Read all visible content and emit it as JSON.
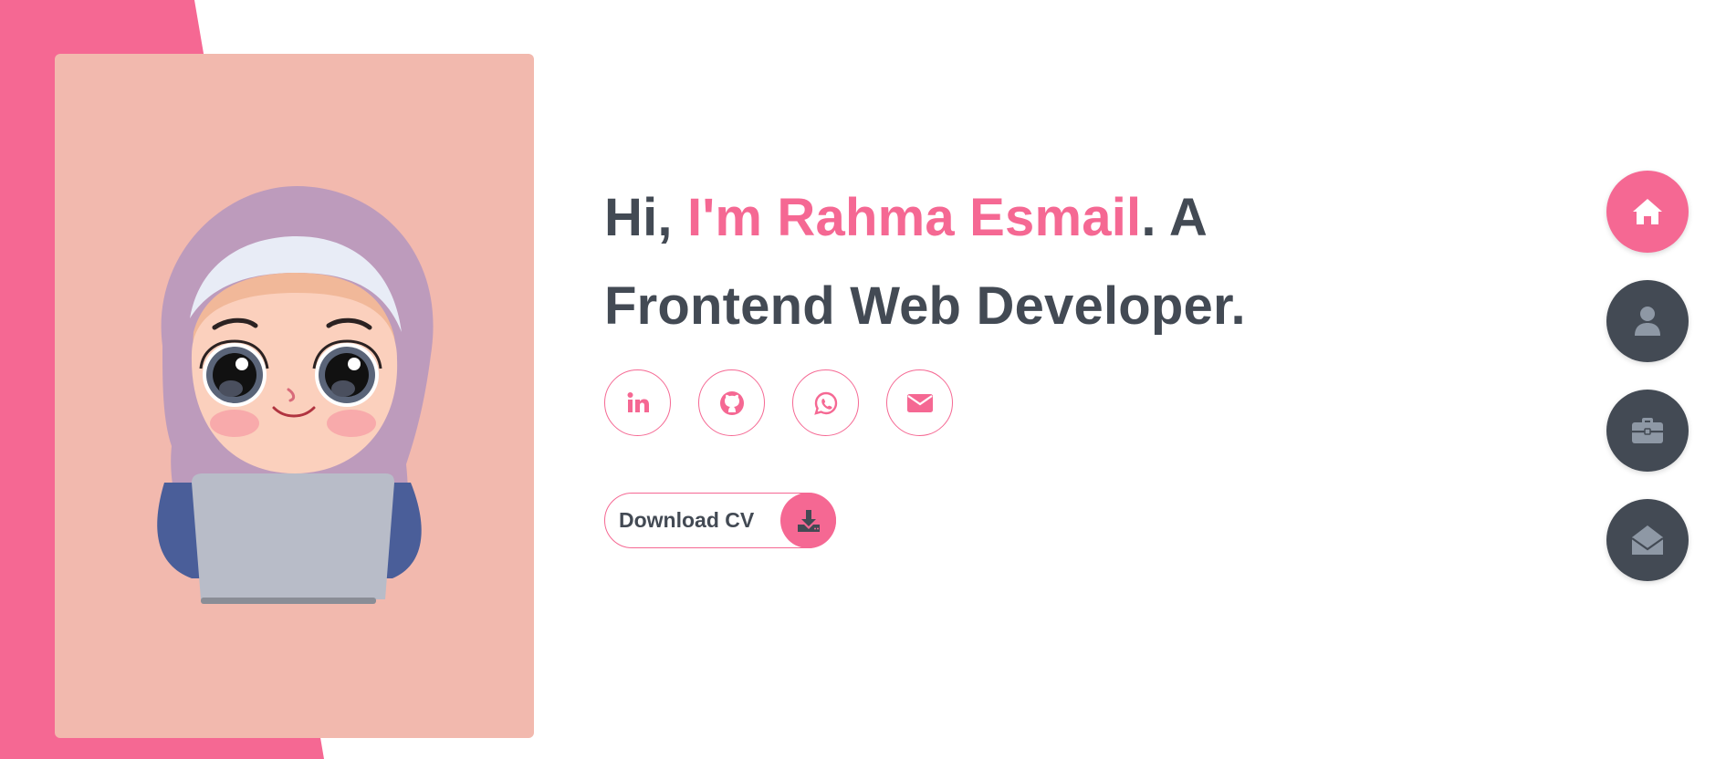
{
  "hero": {
    "greeting": "Hi, ",
    "name": "I'm Rahma Esmail",
    "after_name": ". A",
    "role": "Frontend Web Developer."
  },
  "socials": [
    {
      "name": "linkedin",
      "icon": "linkedin-icon"
    },
    {
      "name": "github",
      "icon": "github-icon"
    },
    {
      "name": "whatsapp",
      "icon": "whatsapp-icon"
    },
    {
      "name": "email",
      "icon": "envelope-icon"
    }
  ],
  "cv_button": {
    "label": "Download CV",
    "icon": "download-icon"
  },
  "side_nav": [
    {
      "icon": "home-icon",
      "active": true
    },
    {
      "icon": "user-icon",
      "active": false
    },
    {
      "icon": "briefcase-icon",
      "active": false
    },
    {
      "icon": "envelope-open-icon",
      "active": false
    }
  ],
  "colors": {
    "accent": "#f56893",
    "dark": "#434a54",
    "card_bg": "#f2b9ae",
    "icon_muted": "#8e98a5"
  }
}
